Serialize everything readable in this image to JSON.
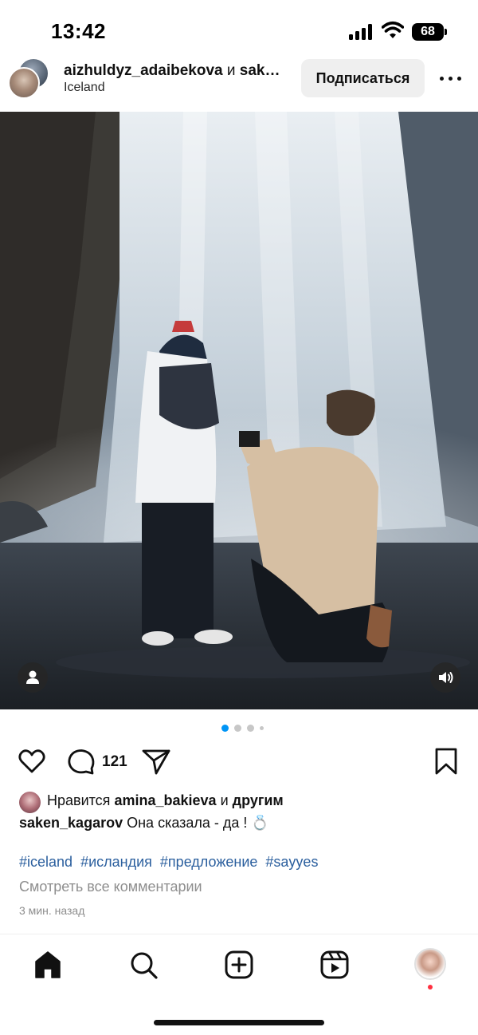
{
  "status_bar": {
    "time": "13:42",
    "battery": "68",
    "icons": [
      "signal-icon",
      "wifi-icon",
      "battery-icon"
    ]
  },
  "post": {
    "header": {
      "username": "aizhuldyz_adaibekova",
      "conjunction": "и",
      "coauthor_truncated": "sak…",
      "location": "Iceland",
      "subscribe_label": "Подписаться",
      "more_icon": "more-horizontal-icon"
    },
    "media": {
      "photo_icons": [
        "user-tag-icon",
        "sound-icon"
      ],
      "carousel_count": 4,
      "carousel_active_index": 0
    },
    "actions": {
      "comment_count": "121",
      "icons": [
        "heart-icon",
        "comment-icon",
        "share-icon",
        "bookmark-icon"
      ]
    },
    "likes": {
      "prefix": "Нравится",
      "user": "amina_bakieva",
      "conj": "и",
      "suffix": "другим"
    },
    "caption": {
      "author": "saken_kagarov",
      "text": "Она сказала - да ! 💍"
    },
    "hashtags": [
      "#iceland",
      "#исландия",
      "#предложение",
      "#sayyes"
    ],
    "view_comments": "Смотреть все комментарии",
    "time_ago": "3 мин. назад"
  },
  "tab_bar": {
    "tabs": [
      "home-icon",
      "search-icon",
      "create-icon",
      "reels-icon",
      "profile-avatar"
    ]
  },
  "colors": {
    "link": "#2b5f9e",
    "muted": "#8e8e8e",
    "carousel_active": "#0095f6",
    "notification_dot": "#ff3040",
    "button_bg": "#efefef"
  }
}
